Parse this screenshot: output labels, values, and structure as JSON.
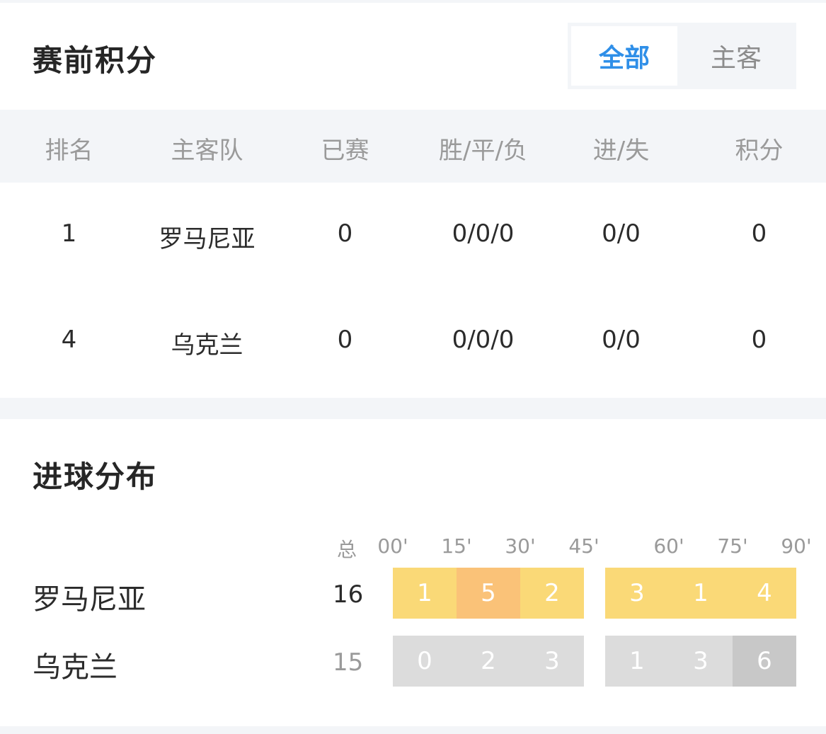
{
  "standings": {
    "title": "赛前积分",
    "tabs": [
      {
        "label": "全部",
        "active": true
      },
      {
        "label": "主客",
        "active": false
      }
    ],
    "headers": [
      "排名",
      "主客队",
      "已赛",
      "胜/平/负",
      "进/失",
      "积分"
    ],
    "rows": [
      {
        "rank": "1",
        "team": "罗马尼亚",
        "played": "0",
        "wdl": "0/0/0",
        "goals": "0/0",
        "points": "0"
      },
      {
        "rank": "4",
        "team": "乌克兰",
        "played": "0",
        "wdl": "0/0/0",
        "goals": "0/0",
        "points": "0"
      }
    ]
  },
  "goal_distribution": {
    "title": "进球分布",
    "total_label": "总",
    "time_ticks": [
      "00'",
      "15'",
      "30'",
      "45'",
      "60'",
      "75'",
      "90'"
    ],
    "teams": [
      {
        "name": "罗马尼亚",
        "total": "16",
        "first_half": [
          "1",
          "5",
          "2"
        ],
        "second_half": [
          "3",
          "1",
          "4"
        ],
        "colors": [
          "#fad977",
          "#fac278",
          "#fad977",
          "#fad977",
          "#fad977",
          "#fad977"
        ],
        "total_color": "#2b2b2b"
      },
      {
        "name": "乌克兰",
        "total": "15",
        "first_half": [
          "0",
          "2",
          "3"
        ],
        "second_half": [
          "1",
          "3",
          "6"
        ],
        "colors": [
          "#dcdcdc",
          "#dcdcdc",
          "#dcdcdc",
          "#dcdcdc",
          "#dcdcdc",
          "#c8c8c8"
        ],
        "total_color": "#9a9a9a"
      }
    ]
  },
  "colors": {
    "accent": "#2f8fe8",
    "panel_bg": "#f3f5f8",
    "header_text": "#9a9a9a"
  }
}
